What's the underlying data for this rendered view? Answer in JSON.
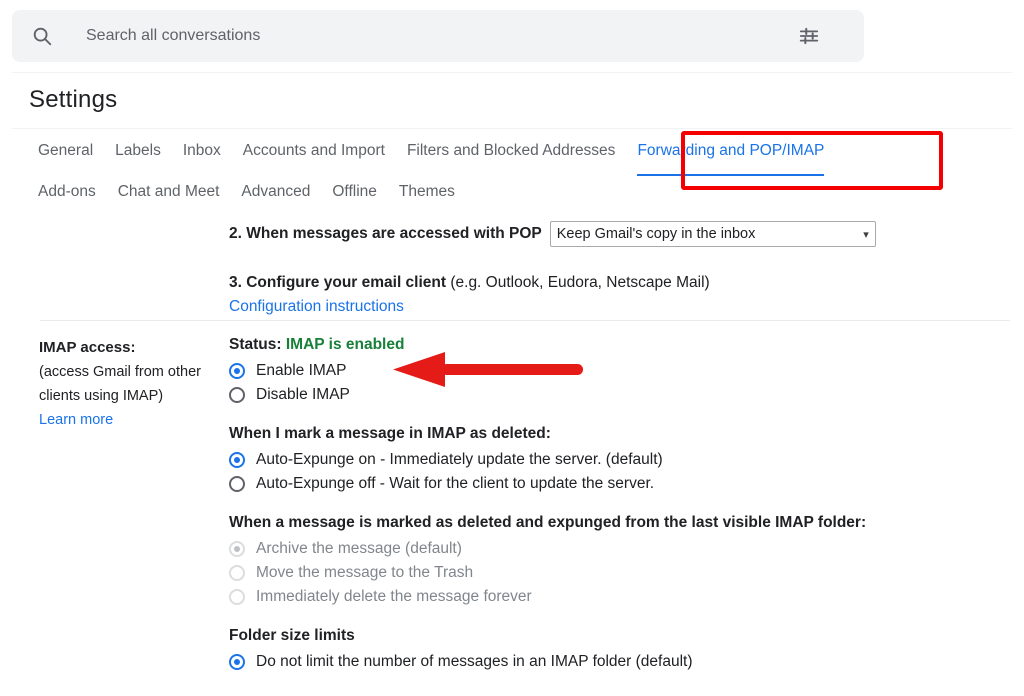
{
  "search": {
    "placeholder": "Search all conversations",
    "value": "",
    "search_icon": "search-icon",
    "filter_icon": "tune-filter-icon"
  },
  "header": {
    "title": "Settings"
  },
  "tabs": {
    "row1": [
      {
        "label": "General",
        "active": false
      },
      {
        "label": "Labels",
        "active": false
      },
      {
        "label": "Inbox",
        "active": false
      },
      {
        "label": "Accounts and Import",
        "active": false
      },
      {
        "label": "Filters and Blocked Addresses",
        "active": false
      },
      {
        "label": "Forwarding and POP/IMAP",
        "active": true
      }
    ],
    "row2": [
      {
        "label": "Add-ons",
        "active": false
      },
      {
        "label": "Chat and Meet",
        "active": false
      },
      {
        "label": "Advanced",
        "active": false
      },
      {
        "label": "Offline",
        "active": false
      },
      {
        "label": "Themes",
        "active": false
      }
    ],
    "active_tab": "Forwarding and POP/IMAP"
  },
  "annotations": {
    "highlight_box_color": "#f40000",
    "arrow_color": "#e01b1b",
    "arrow_target": "Enable IMAP"
  },
  "pop": {
    "step2_label": "2. When messages are accessed with POP",
    "step2_select_value": "Keep Gmail's copy in the inbox",
    "step3_label_bold": "3. Configure your email client",
    "step3_label_rest": " (e.g. Outlook, Eudora, Netscape Mail)",
    "config_link": "Configuration instructions"
  },
  "imap": {
    "left_header": "IMAP access:",
    "left_note_line1": "(access Gmail from other",
    "left_note_line2": "clients using IMAP)",
    "learn_more": "Learn more",
    "status_label": "Status:",
    "status_value": "IMAP is enabled",
    "status_color": "#188038",
    "enable_option": "Enable IMAP",
    "disable_option": "Disable IMAP",
    "enable_selected": true,
    "deleted_group": {
      "title": "When I mark a message in IMAP as deleted:",
      "options": [
        {
          "label": "Auto-Expunge on - Immediately update the server. (default)",
          "selected": true,
          "disabled": false
        },
        {
          "label": "Auto-Expunge off - Wait for the client to update the server.",
          "selected": false,
          "disabled": false
        }
      ]
    },
    "expunged_group": {
      "title": "When a message is marked as deleted and expunged from the last visible IMAP folder:",
      "options": [
        {
          "label": "Archive the message (default)",
          "selected": true,
          "disabled": true
        },
        {
          "label": "Move the message to the Trash",
          "selected": false,
          "disabled": true
        },
        {
          "label": "Immediately delete the message forever",
          "selected": false,
          "disabled": true
        }
      ]
    },
    "folder_group": {
      "title": "Folder size limits",
      "options": [
        {
          "label": "Do not limit the number of messages in an IMAP folder (default)",
          "selected": true,
          "disabled": false
        }
      ]
    }
  }
}
